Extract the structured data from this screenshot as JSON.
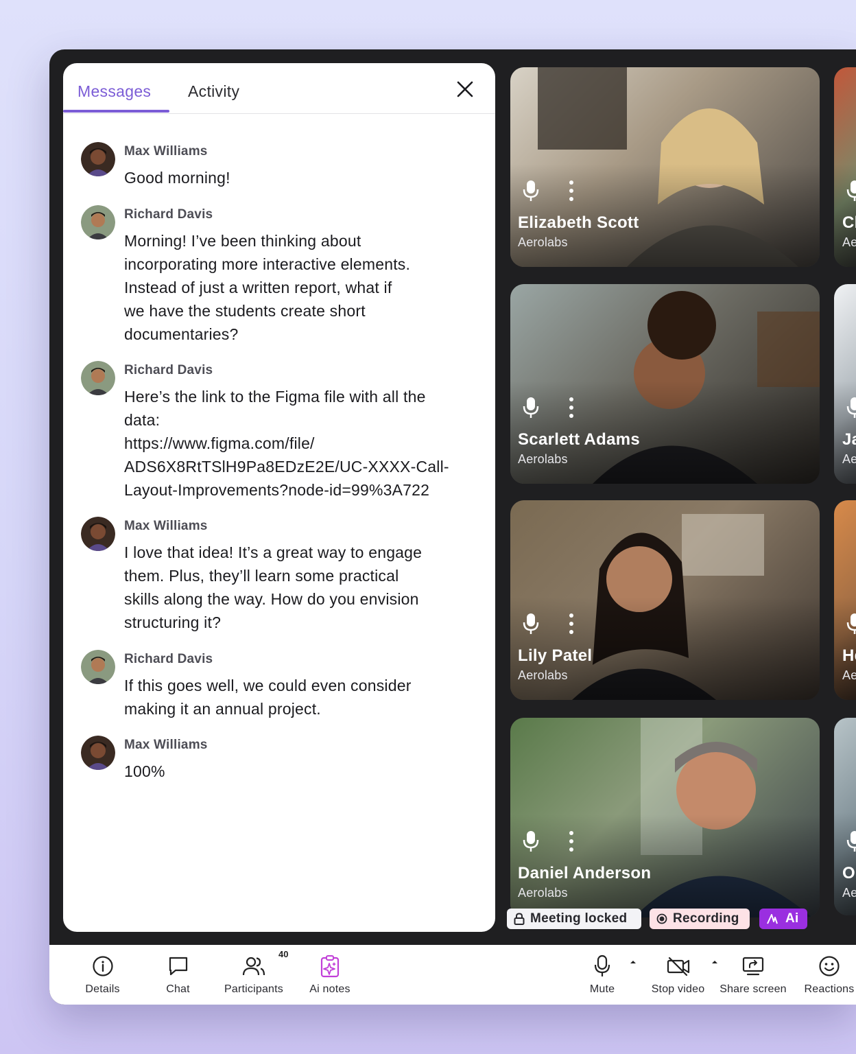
{
  "chat": {
    "tabs": [
      {
        "label": "Messages",
        "active": true
      },
      {
        "label": "Activity",
        "active": false
      }
    ],
    "messages": [
      {
        "sender": "Max Williams",
        "text": "Good morning!"
      },
      {
        "sender": "Richard Davis",
        "text": "Morning! I’ve been thinking about\nincorporating more interactive elements.\nInstead of just a written report, what if\nwe have the students create short\ndocumentaries?"
      },
      {
        "sender": "Richard Davis",
        "text": "Here’s the link to the Figma file with all the\ndata:\nhttps://www.figma.com/file/\nADS6X8RtTSlH9Pa8EDzE2E/UC-XXXX-Call-\nLayout-Improvements?node-id=99%3A722"
      },
      {
        "sender": "Max Williams",
        "text": "I love that idea! It’s a great way to engage\nthem. Plus, they’ll learn some practical\nskills along the way. How do you envision\nstructuring it?"
      },
      {
        "sender": "Richard Davis",
        "text": "If this goes well, we could even consider\nmaking it an annual project."
      },
      {
        "sender": "Max Williams",
        "text": "100%"
      }
    ]
  },
  "participants_main": [
    {
      "name": "Elizabeth Scott",
      "org": "Aerolabs"
    },
    {
      "name": "Scarlett Adams",
      "org": "Aerolabs"
    },
    {
      "name": "Lily Patel",
      "org": "Aerolabs"
    },
    {
      "name": "Daniel Anderson",
      "org": "Aerolabs"
    }
  ],
  "participants_side": [
    {
      "name": "Cl",
      "org": "Ae"
    },
    {
      "name": "Ja",
      "org": "Ae"
    },
    {
      "name": "He",
      "org": "Ae"
    },
    {
      "name": "Ol",
      "org": "Ae"
    }
  ],
  "status": {
    "locked": "Meeting locked",
    "recording": "Recording",
    "ai": "Ai"
  },
  "toolbar": {
    "details": "Details",
    "chat": "Chat",
    "participants": "Participants",
    "participants_count": "40",
    "ai_notes": "Ai notes",
    "mute": "Mute",
    "stop_video": "Stop video",
    "share_screen": "Share screen",
    "reactions": "Reactions"
  },
  "colors": {
    "accent": "#7b5cd6",
    "ai_badge": "#9a2fe0",
    "ai_notes_icon": "#c13fd8",
    "app_bg": "#1f1f21"
  }
}
